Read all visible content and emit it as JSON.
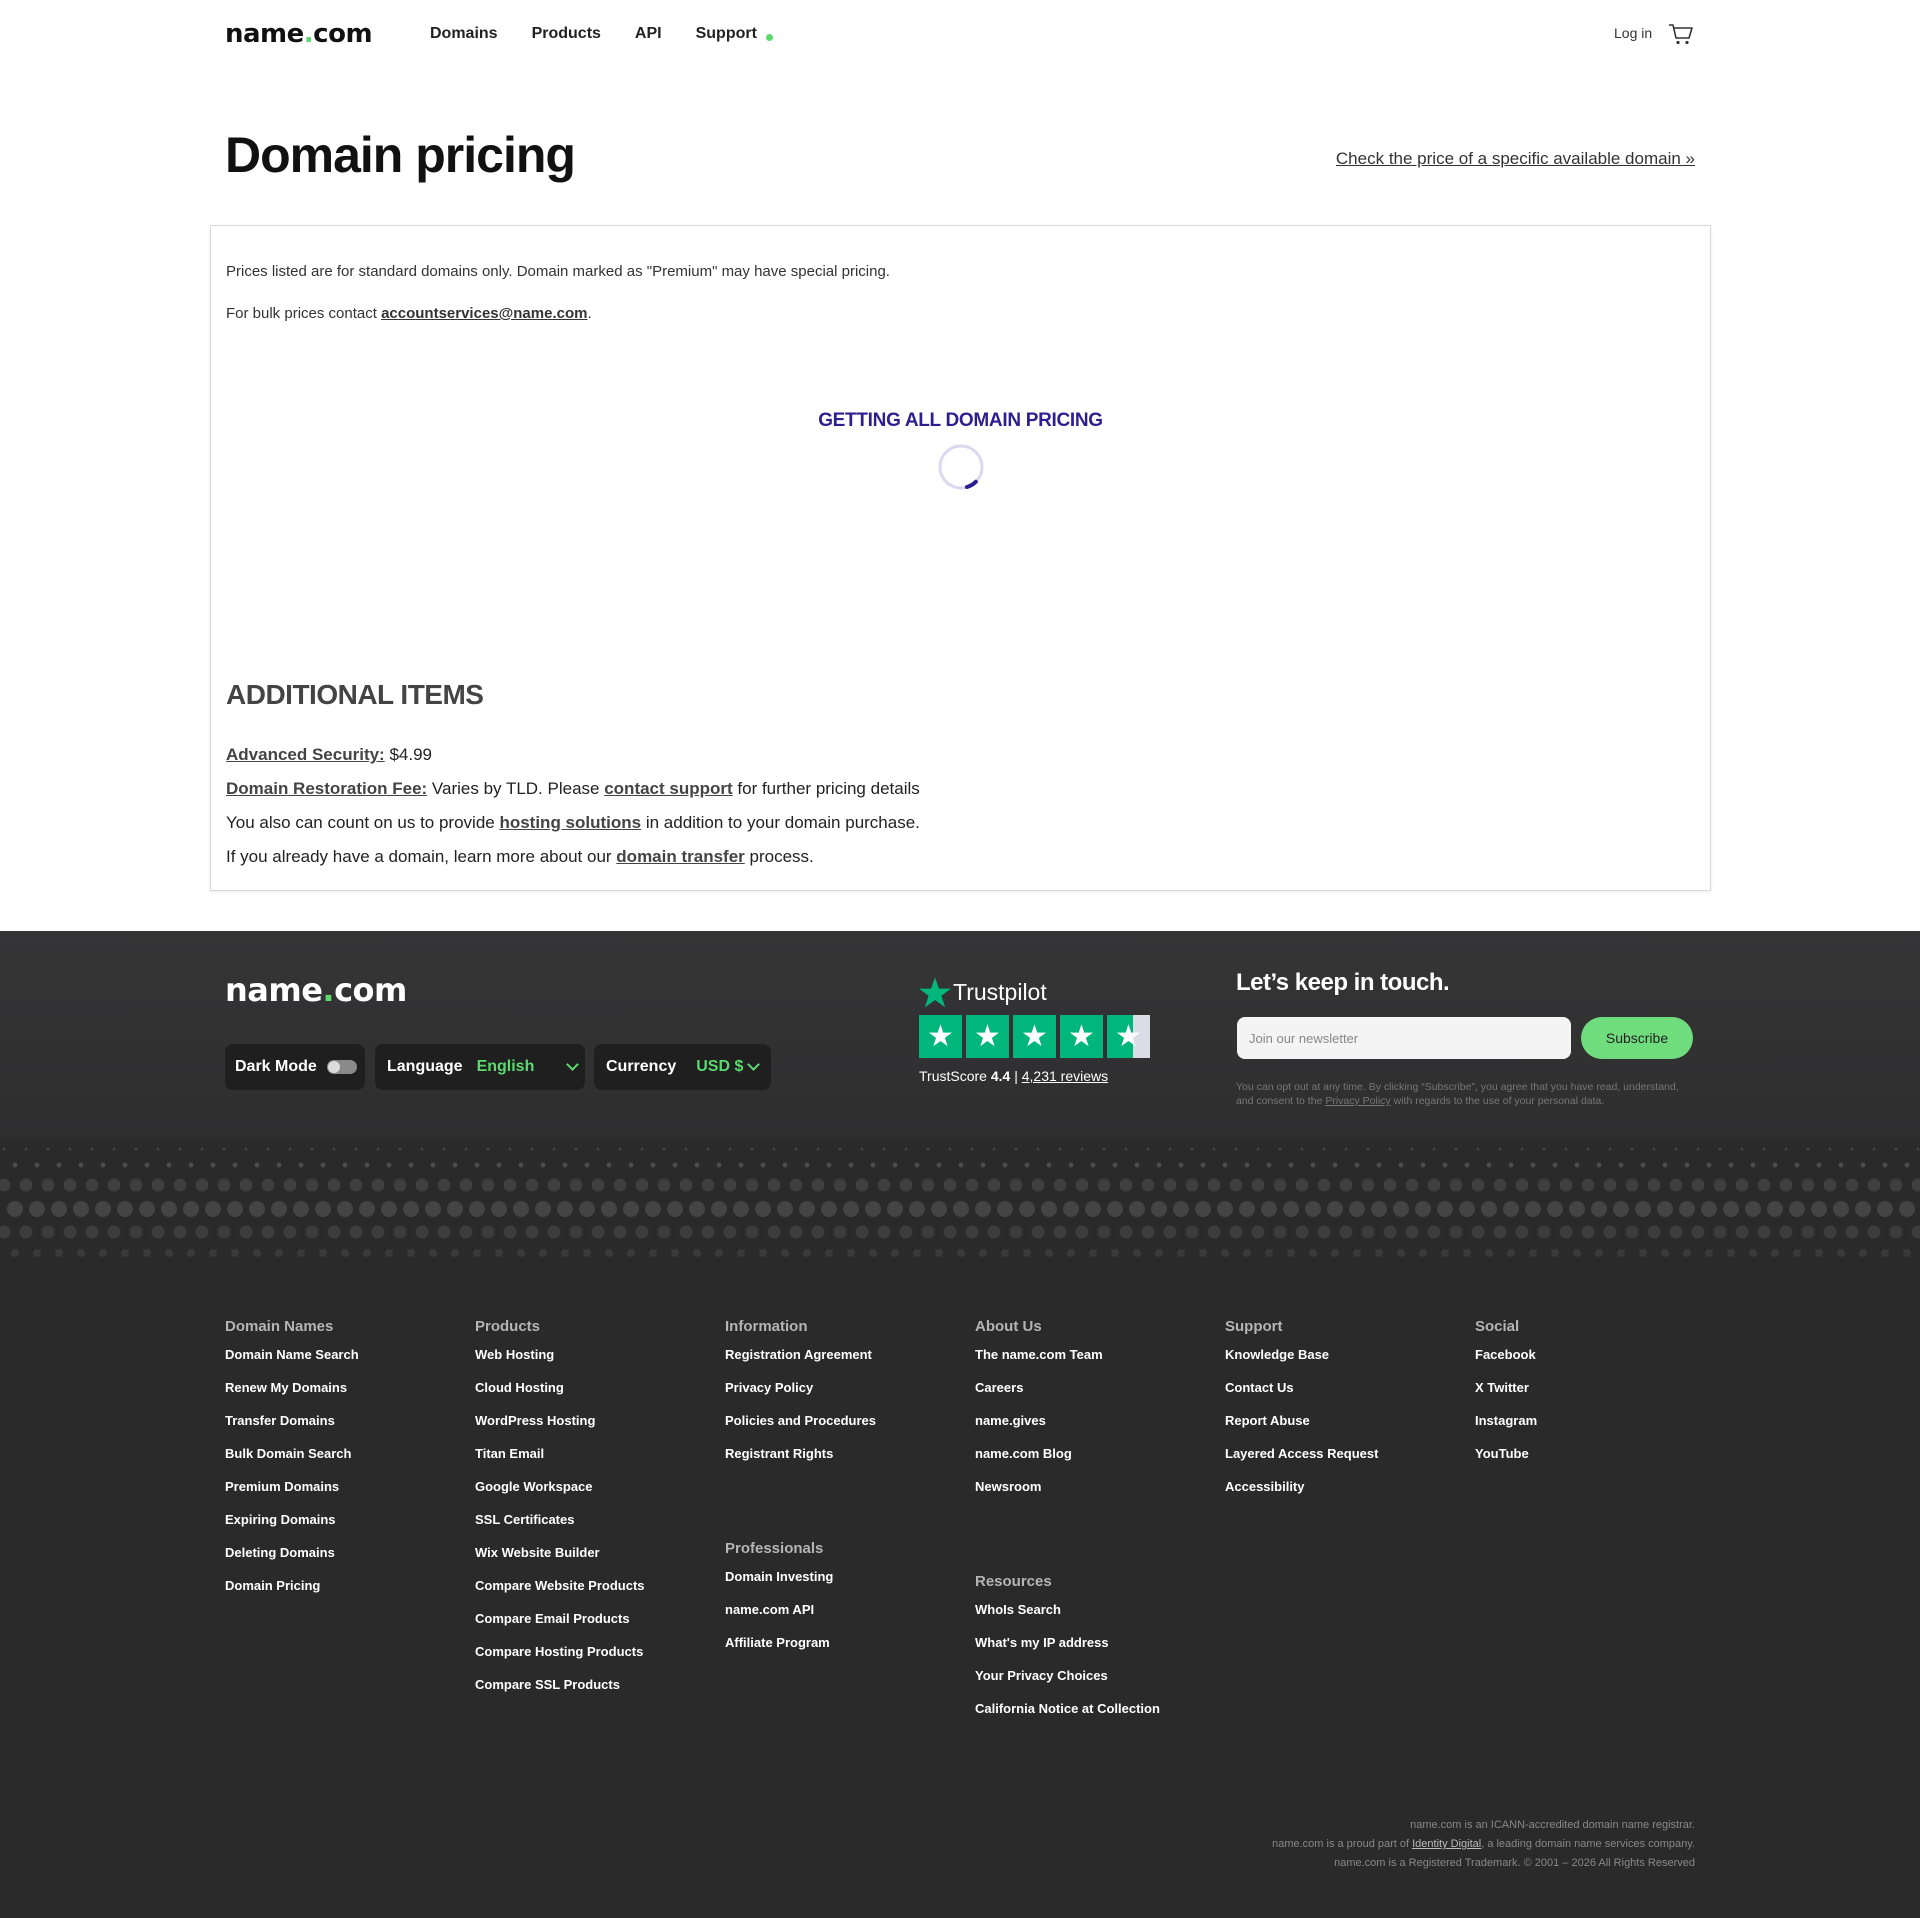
{
  "header": {
    "logo_main": "name",
    "logo_dot": ".",
    "logo_tld": "com",
    "nav": [
      "Domains",
      "Products",
      "API",
      "Support"
    ],
    "login": "Log in"
  },
  "title": "Domain pricing",
  "check_link": "Check the price of a specific available domain »",
  "card": {
    "notice1": "Prices listed are for standard domains only. Domain marked as \"Premium\" may have special pricing.",
    "notice2_prefix": "For bulk prices contact ",
    "notice2_email": "accountservices@name.com",
    "notice2_suffix": ".",
    "loading": "GETTING ALL DOMAIN PRICING",
    "additional_title": "ADDITIONAL ITEMS",
    "security_link": "Advanced Security:",
    "security_price": " $4.99",
    "restore_link": "Domain Restoration Fee:",
    "restore_mid": " Varies by TLD. Please ",
    "restore_contact": "contact support",
    "restore_end": " for further pricing details",
    "hosting_pre": "You also can count on us to provide ",
    "hosting_link": "hosting solutions",
    "hosting_end": " in addition to your domain purchase.",
    "transfer_pre": "If you already have a domain, learn more about our ",
    "transfer_link": "domain transfer",
    "transfer_end": " process."
  },
  "footer": {
    "logo_main": "name",
    "logo_dot": ".",
    "logo_tld": "com",
    "dark_mode": "Dark Mode",
    "language_label": "Language",
    "language_value": "English",
    "currency_label": "Currency",
    "currency_value": "USD $",
    "trustpilot": "Trustpilot",
    "trustscore_label": "TrustScore",
    "trustscore_value": "4.4",
    "trust_sep": " | ",
    "reviews": "4,231 reviews",
    "keep": "Let’s keep in touch.",
    "newsletter_placeholder": "Join our newsletter",
    "subscribe": "Subscribe",
    "optout_pre": "You can opt out at any time. By clicking “Subscribe”, you agree that you have read, understand, and consent to the ",
    "optout_link": "Privacy Policy",
    "optout_end": " with regards to the use of your personal data.",
    "columns": {
      "domain_names": {
        "title": "Domain Names",
        "items": [
          "Domain Name Search",
          "Renew My Domains",
          "Transfer Domains",
          "Bulk Domain Search",
          "Premium Domains",
          "Expiring Domains",
          "Deleting Domains",
          "Domain Pricing"
        ]
      },
      "products": {
        "title": "Products",
        "items": [
          "Web Hosting",
          "Cloud Hosting",
          "WordPress Hosting",
          "Titan Email",
          "Google Workspace",
          "SSL Certificates",
          "Wix Website Builder",
          "Compare Website Products",
          "Compare Email Products",
          "Compare Hosting Products",
          "Compare SSL Products"
        ]
      },
      "information": {
        "title": "Information",
        "items": [
          "Registration Agreement",
          "Privacy Policy",
          "Policies and Procedures",
          "Registrant Rights"
        ]
      },
      "professionals": {
        "title": "Professionals",
        "items": [
          "Domain Investing",
          "name.com API",
          "Affiliate Program"
        ]
      },
      "about": {
        "title": "About Us",
        "items": [
          "The name.com Team",
          "Careers",
          "name.gives",
          "name.com Blog",
          "Newsroom"
        ]
      },
      "resources": {
        "title": "Resources",
        "items": [
          "WhoIs Search",
          "What's my IP address",
          "Your Privacy Choices",
          "California Notice at Collection"
        ]
      },
      "support": {
        "title": "Support",
        "items": [
          "Knowledge Base",
          "Contact Us",
          "Report Abuse",
          "Layered Access Request",
          "Accessibility"
        ]
      },
      "social": {
        "title": "Social",
        "items": [
          "Facebook",
          "X Twitter",
          "Instagram",
          "YouTube"
        ]
      }
    },
    "legal1": "name.com is an ICANN-accredited domain name registrar.",
    "legal2_pre": "name.com is a proud part of ",
    "legal2_link": "Identity Digital",
    "legal2_end": ", a leading domain name services company.",
    "legal3": "name.com is a Registered Trademark. © 2001 – 2026  All Rights Reserved"
  },
  "colors": {
    "brand_green": "#5bd96f",
    "loading_purple": "#2d1f8f",
    "footer_bg": "#2a2a2b"
  }
}
